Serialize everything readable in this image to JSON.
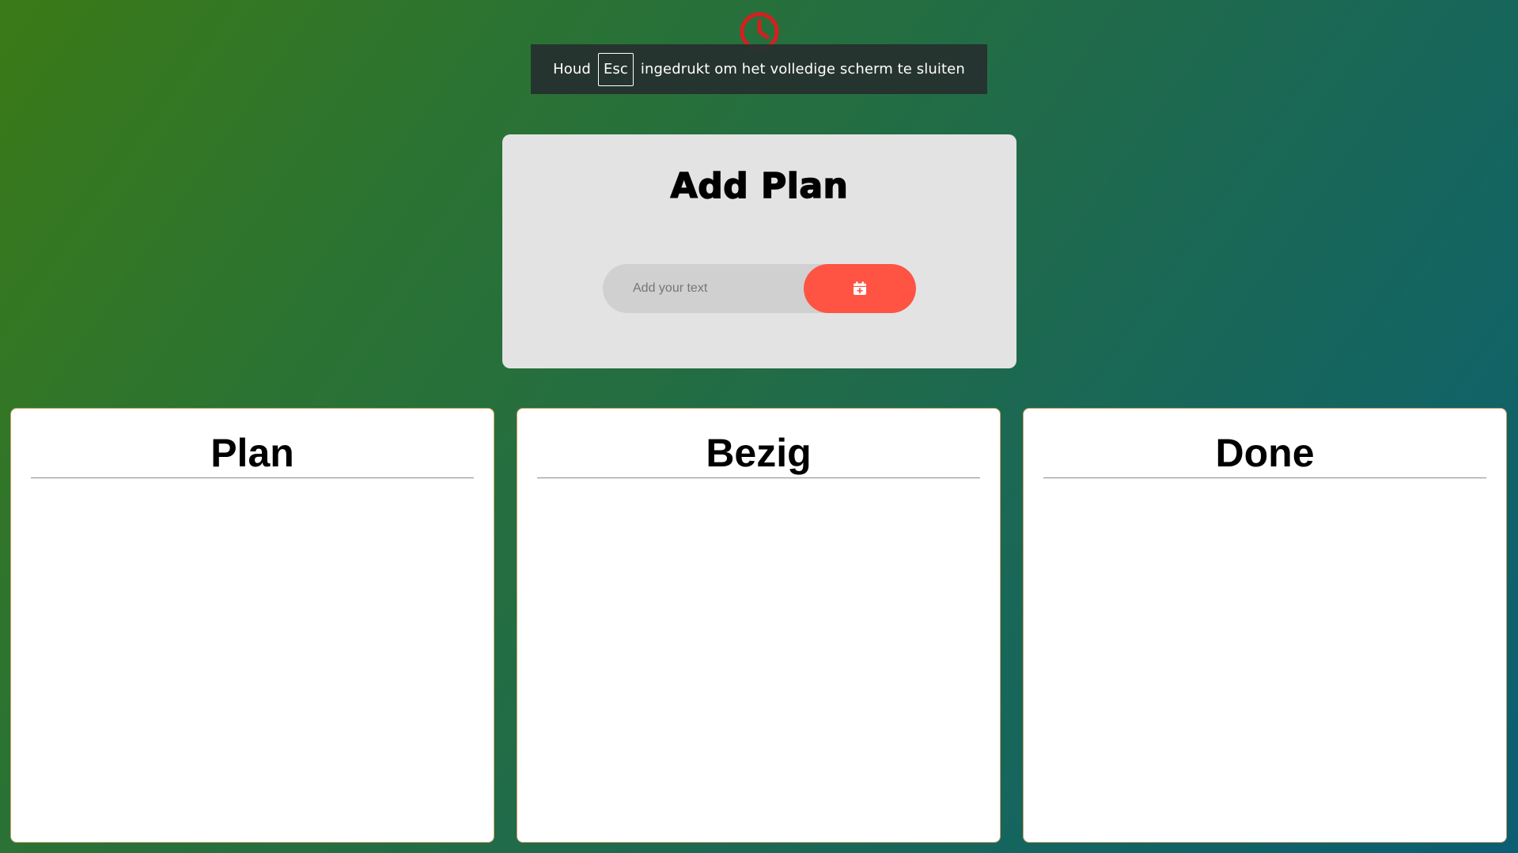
{
  "header": {
    "clock_icon": "clock-icon",
    "clock_text": "",
    "accent_color": "#d42020"
  },
  "fullscreen_toast": {
    "prefix": "Houd",
    "key": "Esc",
    "suffix": "ingedrukt om het volledige scherm te sluiten"
  },
  "add_plan": {
    "title": "Add Plan",
    "input_value": "",
    "input_placeholder": "Add your text",
    "button_icon": "calendar-plus-icon",
    "button_color": "#ff5344"
  },
  "columns": [
    {
      "title": "Plan",
      "items": []
    },
    {
      "title": "Bezig",
      "items": []
    },
    {
      "title": "Done",
      "items": []
    }
  ]
}
